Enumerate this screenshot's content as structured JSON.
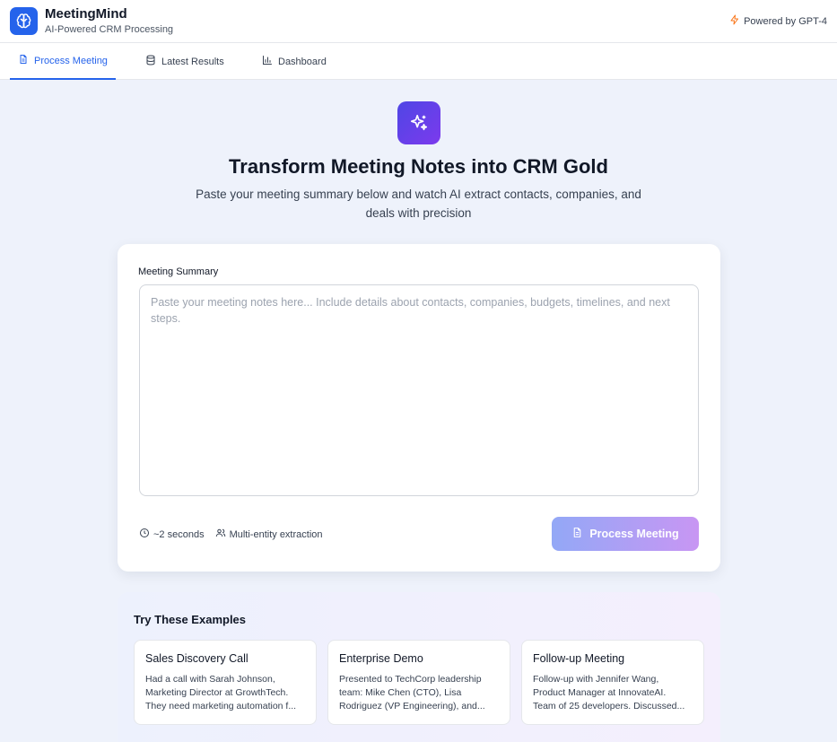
{
  "header": {
    "title": "MeetingMind",
    "subtitle": "AI-Powered CRM Processing",
    "powered_by": "Powered by GPT-4"
  },
  "tabs": [
    {
      "label": "Process Meeting",
      "icon": "document-icon",
      "active": true
    },
    {
      "label": "Latest Results",
      "icon": "database-icon",
      "active": false
    },
    {
      "label": "Dashboard",
      "icon": "bar-chart-icon",
      "active": false
    }
  ],
  "hero": {
    "icon": "sparkles-icon",
    "title": "Transform Meeting Notes into CRM Gold",
    "subtitle": "Paste your meeting summary below and watch AI extract contacts, companies, and deals with precision"
  },
  "form": {
    "label": "Meeting Summary",
    "value": "",
    "placeholder": "Paste your meeting notes here... Include details about contacts, companies, budgets, timelines, and next steps.",
    "meta_time": "~2 seconds",
    "meta_extraction": "Multi-entity extraction",
    "button_label": "Process Meeting"
  },
  "examples": {
    "title": "Try These Examples",
    "items": [
      {
        "title": "Sales Discovery Call",
        "preview_lines": [
          "Had a call with Sarah Johnson,",
          "Marketing Director at GrowthTech.",
          "They need marketing automation f..."
        ]
      },
      {
        "title": "Enterprise Demo",
        "preview_lines": [
          "Presented to TechCorp leadership",
          "team: Mike Chen (CTO), Lisa",
          "Rodriguez (VP Engineering), and..."
        ]
      },
      {
        "title": "Follow-up Meeting",
        "preview_lines": [
          "Follow-up with Jennifer Wang,",
          "Product Manager at InnovateAI.",
          "Team of 25 developers. Discussed..."
        ]
      }
    ]
  },
  "colors": {
    "primary": "#2563eb",
    "accent_gradient_start": "#4f46e5",
    "accent_gradient_end": "#7c3aed",
    "powered_icon": "#f97316",
    "background": "#eef2fb"
  }
}
